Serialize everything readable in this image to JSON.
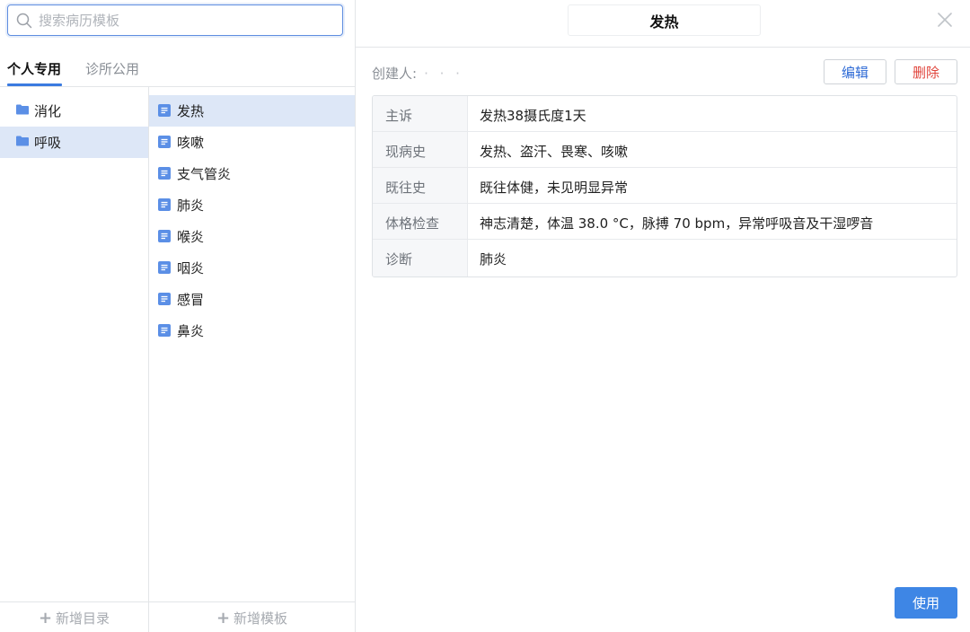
{
  "search": {
    "placeholder": "搜索病历模板",
    "value": ""
  },
  "tabs": [
    {
      "label": "个人专用",
      "active": true
    },
    {
      "label": "诊所公用",
      "active": false
    }
  ],
  "folders": [
    {
      "label": "消化",
      "selected": false
    },
    {
      "label": "呼吸",
      "selected": true
    }
  ],
  "templates": [
    {
      "label": "发热",
      "selected": true
    },
    {
      "label": "咳嗽",
      "selected": false
    },
    {
      "label": "支气管炎",
      "selected": false
    },
    {
      "label": "肺炎",
      "selected": false
    },
    {
      "label": "喉炎",
      "selected": false
    },
    {
      "label": "咽炎",
      "selected": false
    },
    {
      "label": "感冒",
      "selected": false
    },
    {
      "label": "鼻炎",
      "selected": false
    }
  ],
  "footer": {
    "add_folder": "新增目录",
    "add_template": "新增模板"
  },
  "detail": {
    "title": "发热",
    "creator_label": "创建人:",
    "creator_value": "· · ·",
    "edit_label": "编辑",
    "delete_label": "删除",
    "use_label": "使用",
    "fields": [
      {
        "label": "主诉",
        "value": "发热38摄氏度1天"
      },
      {
        "label": "现病史",
        "value": "发热、盗汗、畏寒、咳嗽"
      },
      {
        "label": "既往史",
        "value": "既往体健，未见明显异常"
      },
      {
        "label": "体格检查",
        "value": "神志清楚，体温 38.0 °C，脉搏 70 bpm，异常呼吸音及干湿啰音"
      },
      {
        "label": "诊断",
        "value": "肺炎"
      }
    ]
  },
  "colors": {
    "accent": "#3b7be0",
    "selected_bg": "#dde7f7",
    "danger": "#e0453c",
    "folder": "#5b8fe6",
    "doc": "#5b8fe6"
  },
  "icons": {
    "search": "search-icon",
    "folder": "folder-icon",
    "document": "document-icon",
    "close": "close-icon",
    "plus": "plus-icon"
  }
}
